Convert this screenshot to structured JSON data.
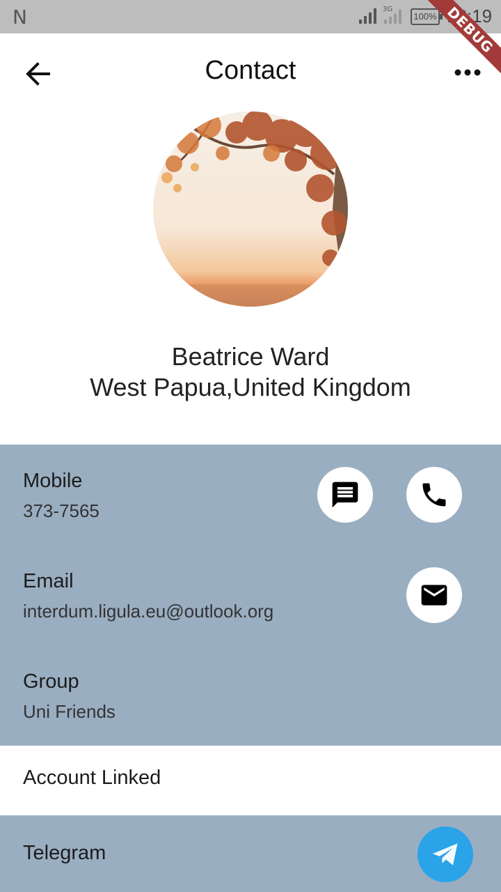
{
  "status_bar": {
    "carrier_glyph": "N",
    "network_label": "3G",
    "battery": "100%",
    "time": "18:19",
    "debug_banner": "DEBUG"
  },
  "app_bar": {
    "title": "Contact"
  },
  "contact": {
    "name": "Beatrice Ward",
    "location": "West Papua,United Kingdom",
    "mobile_label": "Mobile",
    "mobile_value": "373-7565",
    "email_label": "Email",
    "email_value": "interdum.ligula.eu@outlook.org",
    "group_label": "Group",
    "group_value": "Uni Friends"
  },
  "linked": {
    "heading": "Account Linked",
    "items": [
      {
        "label": "Telegram",
        "icon": "telegram-icon"
      }
    ]
  },
  "colors": {
    "info_background": "#9aaec1",
    "telegram": "#2aa3e8",
    "status_bar": "#bdbdbd",
    "debug_ribbon": "#a33a3a"
  }
}
